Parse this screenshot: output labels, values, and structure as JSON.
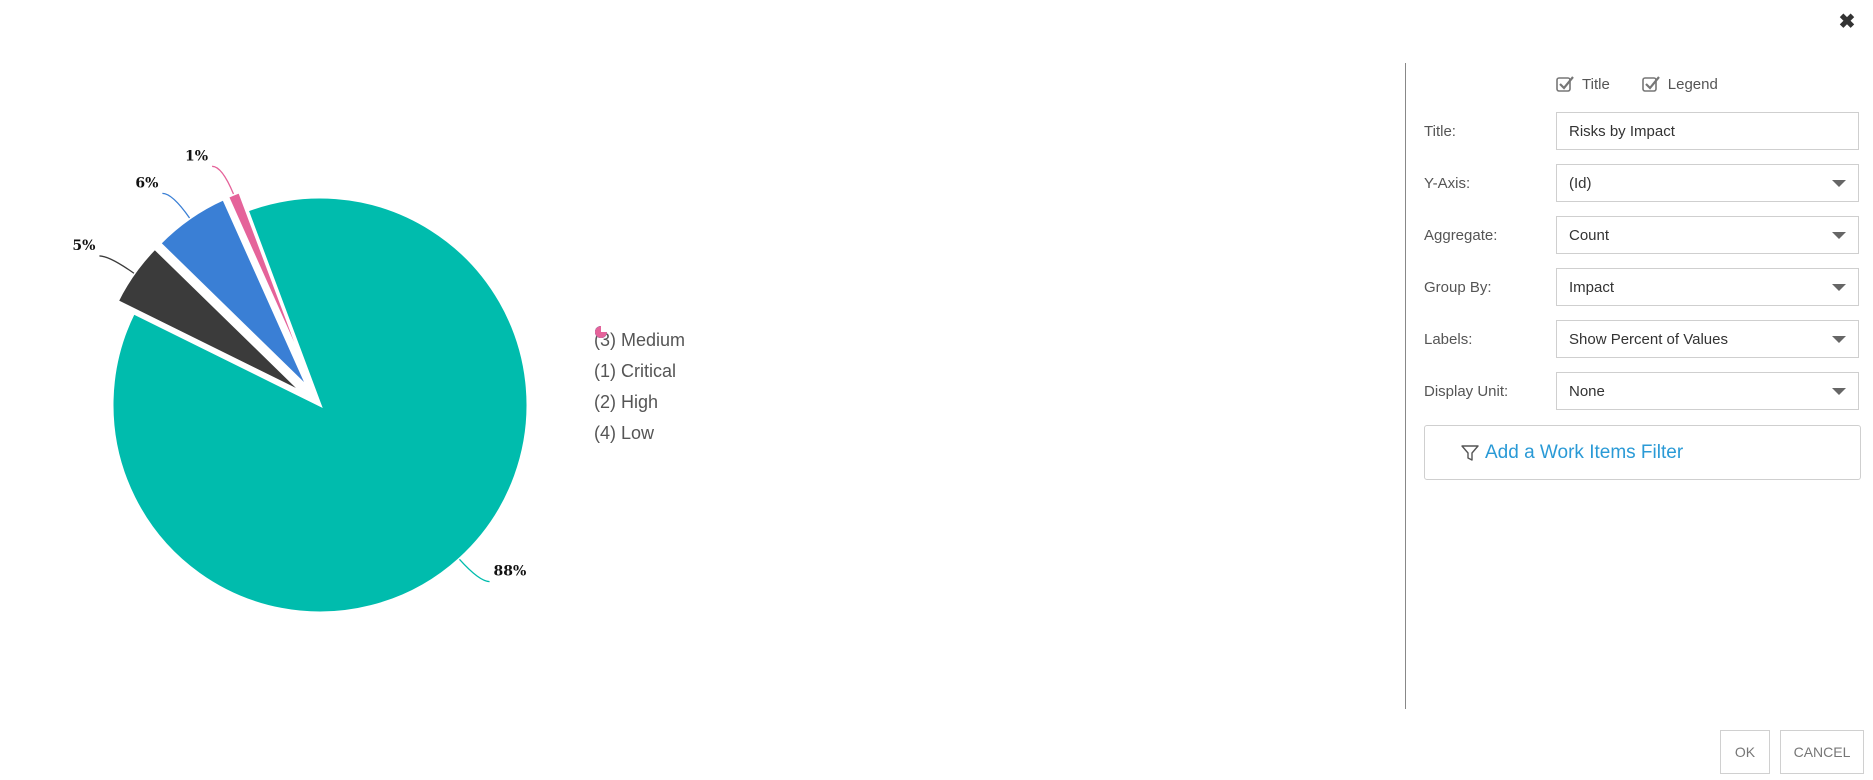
{
  "dialog": {
    "close_icon": "close-icon"
  },
  "chart_data": {
    "type": "pie",
    "title": "",
    "slices": [
      {
        "label": "(3) Medium",
        "value": 88,
        "color": "#00bcad"
      },
      {
        "label": "(1) Critical",
        "value": 5,
        "color": "#3b3b3b"
      },
      {
        "label": "(2) High",
        "value": 6,
        "color": "#3a7fd5"
      },
      {
        "label": "(4) Low",
        "value": 1,
        "color": "#e5639a"
      }
    ],
    "data_labels": [
      "88%",
      "5%",
      "6%",
      "1%"
    ],
    "legend_placement": "right"
  },
  "panel": {
    "title_check": "Title",
    "legend_check": "Legend",
    "fields": [
      {
        "label": "Title:",
        "value": "Risks by Impact",
        "type": "text"
      },
      {
        "label": "Y-Axis:",
        "value": "(Id)",
        "type": "select"
      },
      {
        "label": "Aggregate:",
        "value": "Count",
        "type": "select"
      },
      {
        "label": "Group By:",
        "value": "Impact",
        "type": "select"
      },
      {
        "label": "Labels:",
        "value": "Show Percent of Values",
        "type": "select"
      },
      {
        "label": "Display Unit:",
        "value": "None",
        "type": "select"
      }
    ],
    "filter_label": "Add a Work Items Filter"
  },
  "footer": {
    "ok_label": "OK",
    "cancel_label": "CANCEL"
  }
}
